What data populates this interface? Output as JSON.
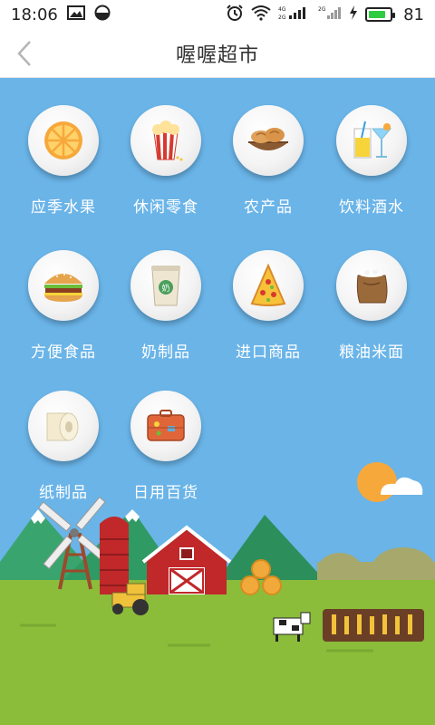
{
  "status_bar": {
    "time": "18:06",
    "battery_level": "81",
    "battery_fraction": 0.81
  },
  "header": {
    "title": "喔喔超市"
  },
  "categories": [
    {
      "label": "应季水果",
      "icon": "orange-slice-icon"
    },
    {
      "label": "休闲零食",
      "icon": "popcorn-icon"
    },
    {
      "label": "农产品",
      "icon": "bread-basket-icon"
    },
    {
      "label": "饮料酒水",
      "icon": "drinks-icon"
    },
    {
      "label": "方便食品",
      "icon": "burger-icon"
    },
    {
      "label": "奶制品",
      "icon": "milk-cup-icon"
    },
    {
      "label": "进口商品",
      "icon": "pizza-icon"
    },
    {
      "label": "粮油米面",
      "icon": "rice-sack-icon"
    },
    {
      "label": "纸制品",
      "icon": "tissue-roll-icon"
    },
    {
      "label": "日用百货",
      "icon": "suitcase-icon"
    }
  ],
  "colors": {
    "sky": "#6ab4e8",
    "grass": "#8bbd3b",
    "barn": "#c0282a",
    "sun": "#f7a83a"
  }
}
